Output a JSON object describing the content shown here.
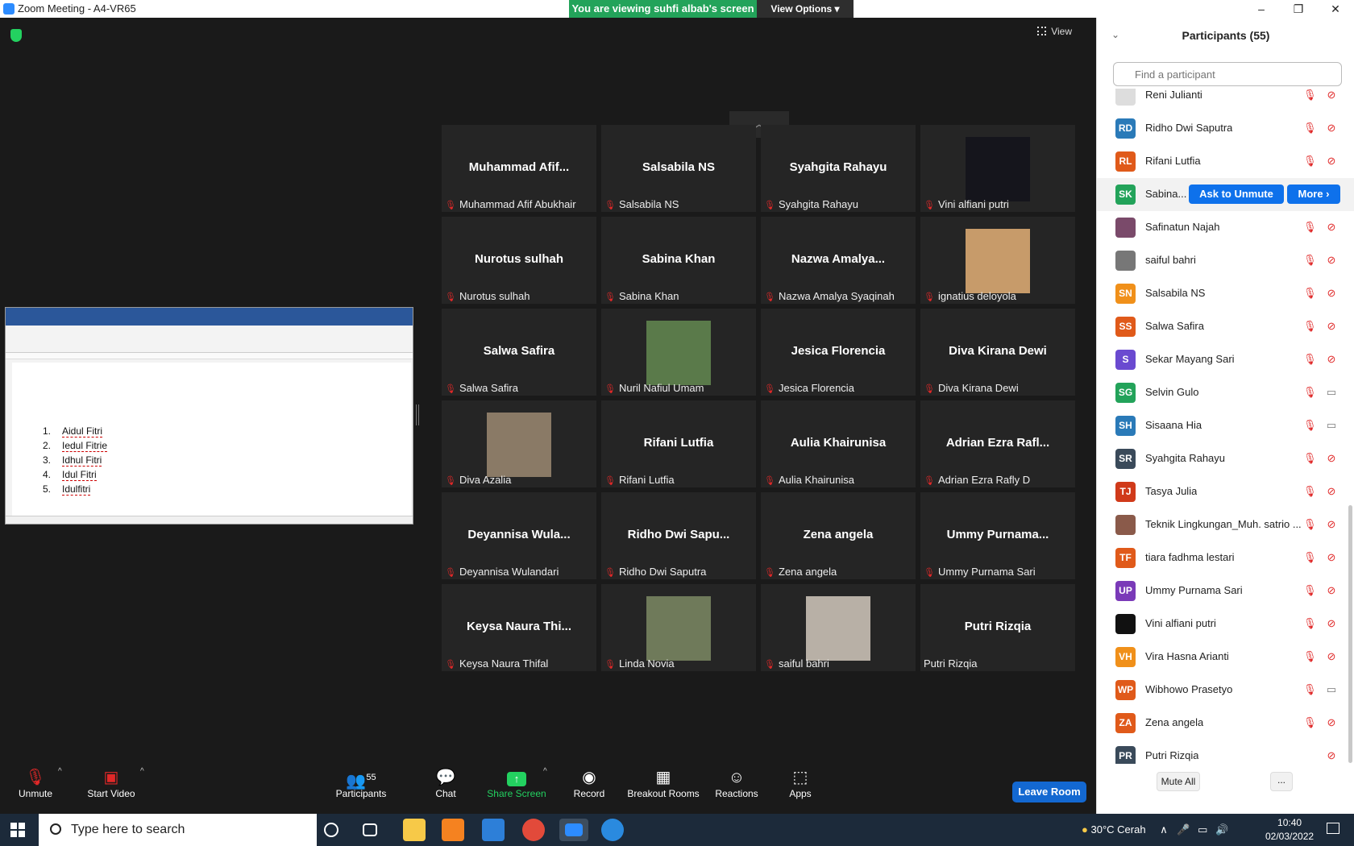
{
  "window": {
    "title": "Zoom Meeting - A4-VR65",
    "minimize": "–",
    "maximize": "❐",
    "close": "✕"
  },
  "banner": {
    "viewing": "You are viewing suhfi albab's screen",
    "view_options": "View Options ▾"
  },
  "meeting": {
    "view_label": "View",
    "scroll_up": "︿"
  },
  "document": {
    "items": [
      {
        "num": "1.",
        "text": "Aidul Fitri"
      },
      {
        "num": "2.",
        "text": "Iedul Fitrie"
      },
      {
        "num": "3.",
        "text": "Idhul Fitri"
      },
      {
        "num": "4.",
        "text": "Idul Fitri"
      },
      {
        "num": "5.",
        "text": "Idulfitri"
      }
    ]
  },
  "gallery": [
    {
      "display": "Muhammad Afif...",
      "label": "Muhammad Afif Abukhair",
      "muted": true,
      "video": ""
    },
    {
      "display": "Salsabila NS",
      "label": "Salsabila NS",
      "muted": true,
      "video": ""
    },
    {
      "display": "Syahgita Rahayu",
      "label": "Syahgita Rahayu",
      "muted": true,
      "video": ""
    },
    {
      "display": "",
      "label": "Vini alfiani putri",
      "muted": true,
      "video": "#15151c"
    },
    {
      "display": "Nurotus sulhah",
      "label": "Nurotus sulhah",
      "muted": true,
      "video": ""
    },
    {
      "display": "Sabina Khan",
      "label": "Sabina Khan",
      "muted": true,
      "video": ""
    },
    {
      "display": "Nazwa Amalya...",
      "label": "Nazwa Amalya Syaqinah",
      "muted": true,
      "video": ""
    },
    {
      "display": "",
      "label": "ignatius deloyola",
      "muted": true,
      "video": "#c79b6a"
    },
    {
      "display": "Salwa Safira",
      "label": "Salwa Safira",
      "muted": true,
      "video": ""
    },
    {
      "display": "",
      "label": "Nuril Nafiul Umam",
      "muted": true,
      "video": "#5a7a4a"
    },
    {
      "display": "Jesica Florencia",
      "label": "Jesica Florencia",
      "muted": true,
      "video": ""
    },
    {
      "display": "Diva Kirana Dewi",
      "label": "Diva Kirana Dewi",
      "muted": true,
      "video": ""
    },
    {
      "display": "",
      "label": "Diva Azalia",
      "muted": true,
      "video": "#8a7a66"
    },
    {
      "display": "Rifani Lutfia",
      "label": "Rifani Lutfia",
      "muted": true,
      "video": ""
    },
    {
      "display": "Aulia Khairunisa",
      "label": "Aulia Khairunisa",
      "muted": true,
      "video": ""
    },
    {
      "display": "Adrian Ezra Rafl...",
      "label": "Adrian Ezra Rafly D",
      "muted": true,
      "video": ""
    },
    {
      "display": "Deyannisa Wula...",
      "label": "Deyannisa Wulandari",
      "muted": true,
      "video": ""
    },
    {
      "display": "Ridho Dwi Sapu...",
      "label": "Ridho Dwi Saputra",
      "muted": true,
      "video": ""
    },
    {
      "display": "Zena angela",
      "label": "Zena angela",
      "muted": true,
      "video": ""
    },
    {
      "display": "Ummy Purnama...",
      "label": "Ummy Purnama Sari",
      "muted": true,
      "video": ""
    },
    {
      "display": "Keysa Naura Thi...",
      "label": "Keysa Naura Thifal",
      "muted": true,
      "video": ""
    },
    {
      "display": "",
      "label": "Linda Novia",
      "muted": true,
      "video": "#6f7a5a"
    },
    {
      "display": "",
      "label": "saiful bahri",
      "muted": true,
      "video": "#b8b0a6"
    },
    {
      "display": "Putri Rizqia",
      "label": "Putri Rizqia",
      "muted": false,
      "video": ""
    }
  ],
  "participants": {
    "title": "Participants (55)",
    "search_placeholder": "Find a participant",
    "ask_to_unmute": "Ask to Unmute",
    "more": "More ›",
    "mute_all": "Mute All",
    "more_dots": "...",
    "list": [
      {
        "initials": "",
        "name": "Reni Julianti",
        "color": "#dddddd",
        "mic": true,
        "cam_off": true
      },
      {
        "initials": "RD",
        "name": "Ridho Dwi Saputra",
        "color": "#2a7ab8",
        "mic": true,
        "cam_off": true
      },
      {
        "initials": "RL",
        "name": "Rifani Lutfia",
        "color": "#e05a1a",
        "mic": true,
        "cam_off": true
      },
      {
        "initials": "SK",
        "name": "Sabina...",
        "color": "#23a35a",
        "mic": false,
        "cam_off": false,
        "hover": true
      },
      {
        "initials": "",
        "name": "Safinatun Najah",
        "color": "#7a4a6a",
        "mic": true,
        "cam_off": true
      },
      {
        "initials": "",
        "name": "saiful bahri",
        "color": "#777777",
        "mic": true,
        "cam_off": true
      },
      {
        "initials": "SN",
        "name": "Salsabila NS",
        "color": "#f0901a",
        "mic": true,
        "cam_off": true
      },
      {
        "initials": "SS",
        "name": "Salwa Safira",
        "color": "#e05a1a",
        "mic": true,
        "cam_off": true
      },
      {
        "initials": "S",
        "name": "Sekar Mayang Sari",
        "color": "#6a4ad0",
        "mic": true,
        "cam_off": true
      },
      {
        "initials": "SG",
        "name": "Selvin Gulo",
        "color": "#23a35a",
        "mic": true,
        "cam_off": false
      },
      {
        "initials": "SH",
        "name": "Sisaana Hia",
        "color": "#2a7ab8",
        "mic": true,
        "cam_off": false
      },
      {
        "initials": "SR",
        "name": "Syahgita Rahayu",
        "color": "#3a4a5a",
        "mic": true,
        "cam_off": true
      },
      {
        "initials": "TJ",
        "name": "Tasya Julia",
        "color": "#d03a1a",
        "mic": true,
        "cam_off": true
      },
      {
        "initials": "",
        "name": "Teknik Lingkungan_Muh. satrio ...",
        "color": "#8a5a4a",
        "mic": true,
        "cam_off": true
      },
      {
        "initials": "TF",
        "name": "tiara fadhma lestari",
        "color": "#e05a1a",
        "mic": true,
        "cam_off": true
      },
      {
        "initials": "UP",
        "name": "Ummy Purnama Sari",
        "color": "#7a3ab8",
        "mic": true,
        "cam_off": true
      },
      {
        "initials": "",
        "name": "Vini alfiani putri",
        "color": "#111111",
        "mic": true,
        "cam_off": true
      },
      {
        "initials": "VH",
        "name": "Vira Hasna Arianti",
        "color": "#f0901a",
        "mic": true,
        "cam_off": true
      },
      {
        "initials": "WP",
        "name": "Wibhowo Prasetyo",
        "color": "#e05a1a",
        "mic": true,
        "cam_off": false
      },
      {
        "initials": "ZA",
        "name": "Zena angela",
        "color": "#e05a1a",
        "mic": true,
        "cam_off": true
      },
      {
        "initials": "PR",
        "name": "Putri Rizqia",
        "color": "#3a4a5a",
        "mic": false,
        "cam_off": true
      }
    ]
  },
  "toolbar": {
    "unmute": "Unmute",
    "start_video": "Start Video",
    "participants": "Participants",
    "participants_count": "55",
    "chat": "Chat",
    "share_screen": "Share Screen",
    "record": "Record",
    "breakout_rooms": "Breakout Rooms",
    "reactions": "Reactions",
    "apps": "Apps",
    "leave": "Leave Room"
  },
  "taskbar": {
    "search_placeholder": "Type here to search",
    "weather": "30°C  Cerah",
    "time": "10:40",
    "date": "02/03/2022"
  }
}
